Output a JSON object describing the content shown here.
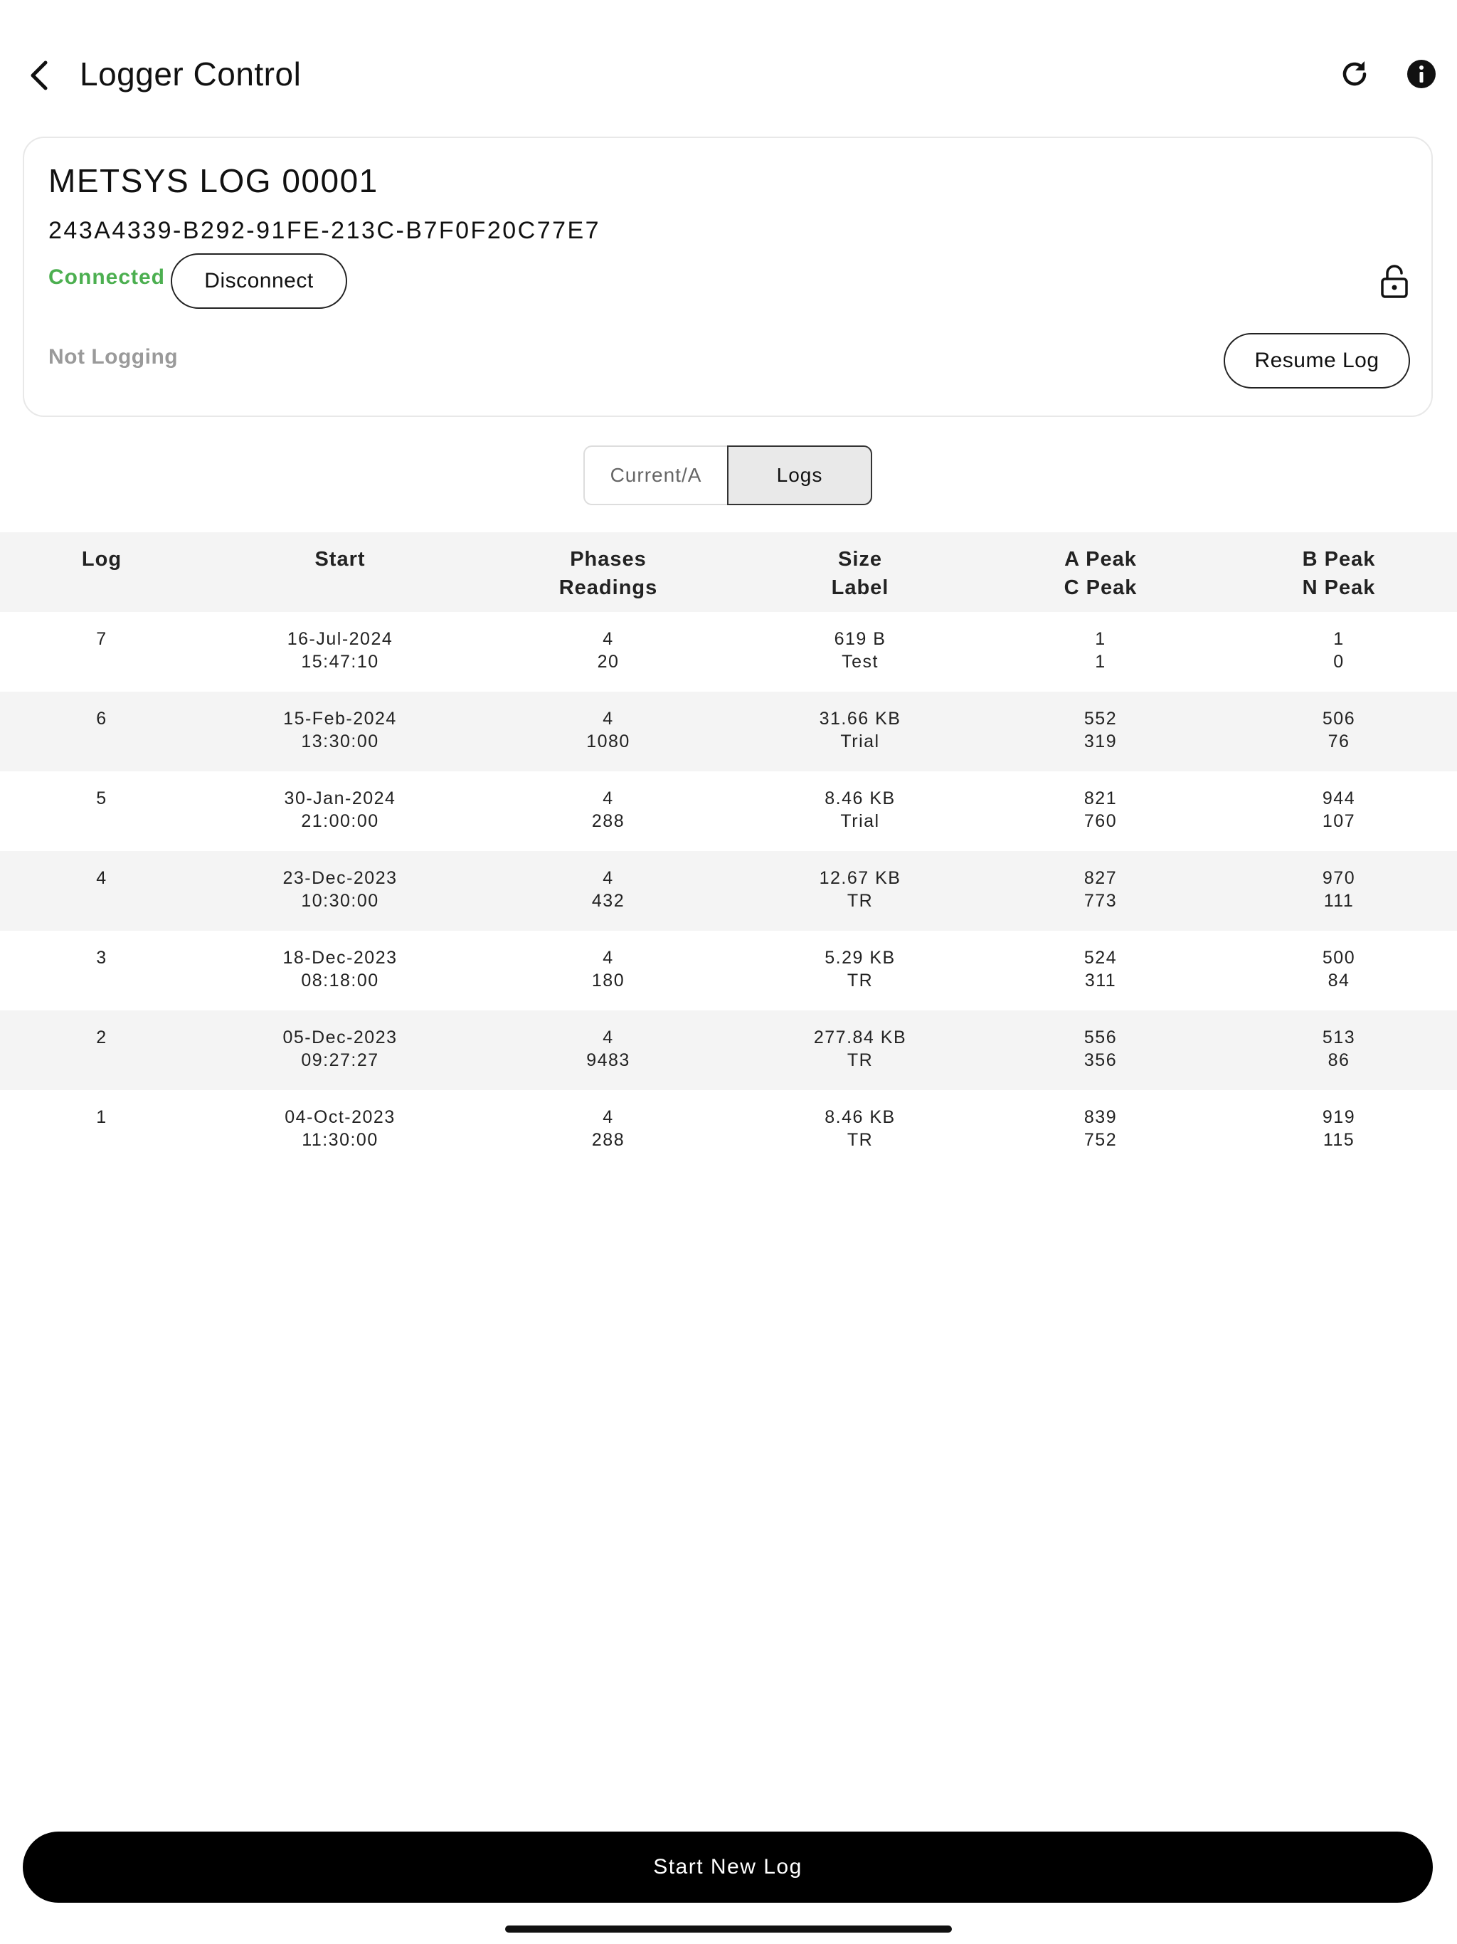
{
  "header": {
    "title": "Logger Control",
    "back_icon": "chevron-left-icon",
    "refresh_icon": "refresh-icon",
    "info_icon": "info-icon"
  },
  "device": {
    "name": "METSYS LOG 00001",
    "id": "243A4339-B292-91FE-213C-B7F0F20C77E7",
    "connection_status": "Connected",
    "disconnect_label": "Disconnect",
    "lock_icon": "unlock-icon",
    "logging_status": "Not Logging",
    "resume_label": "Resume Log"
  },
  "tabs": {
    "current": "Current/A",
    "logs": "Logs",
    "selected": "Logs"
  },
  "table": {
    "headers": [
      [
        "Log",
        ""
      ],
      [
        "Start",
        ""
      ],
      [
        "Phases",
        "Readings"
      ],
      [
        "Size",
        "Label"
      ],
      [
        "A Peak",
        "C Peak"
      ],
      [
        "B Peak",
        "N Peak"
      ]
    ],
    "rows": [
      [
        [
          "7",
          ""
        ],
        [
          "16-Jul-2024",
          "15:47:10"
        ],
        [
          "4",
          "20"
        ],
        [
          "619 B",
          "Test"
        ],
        [
          "1",
          "1"
        ],
        [
          "1",
          "0"
        ]
      ],
      [
        [
          "6",
          ""
        ],
        [
          "15-Feb-2024",
          "13:30:00"
        ],
        [
          "4",
          "1080"
        ],
        [
          "31.66 KB",
          "Trial"
        ],
        [
          "552",
          "319"
        ],
        [
          "506",
          "76"
        ]
      ],
      [
        [
          "5",
          ""
        ],
        [
          "30-Jan-2024",
          "21:00:00"
        ],
        [
          "4",
          "288"
        ],
        [
          "8.46 KB",
          "Trial"
        ],
        [
          "821",
          "760"
        ],
        [
          "944",
          "107"
        ]
      ],
      [
        [
          "4",
          ""
        ],
        [
          "23-Dec-2023",
          "10:30:00"
        ],
        [
          "4",
          "432"
        ],
        [
          "12.67 KB",
          "TR"
        ],
        [
          "827",
          "773"
        ],
        [
          "970",
          "111"
        ]
      ],
      [
        [
          "3",
          ""
        ],
        [
          "18-Dec-2023",
          "08:18:00"
        ],
        [
          "4",
          "180"
        ],
        [
          "5.29 KB",
          "TR"
        ],
        [
          "524",
          "311"
        ],
        [
          "500",
          "84"
        ]
      ],
      [
        [
          "2",
          ""
        ],
        [
          "05-Dec-2023",
          "09:27:27"
        ],
        [
          "4",
          "9483"
        ],
        [
          "277.84 KB",
          "TR"
        ],
        [
          "556",
          "356"
        ],
        [
          "513",
          "86"
        ]
      ],
      [
        [
          "1",
          ""
        ],
        [
          "04-Oct-2023",
          "11:30:00"
        ],
        [
          "4",
          "288"
        ],
        [
          "8.46 KB",
          "TR"
        ],
        [
          "839",
          "752"
        ],
        [
          "919",
          "115"
        ]
      ]
    ]
  },
  "footer": {
    "start_label": "Start New Log"
  },
  "colors": {
    "connected": "#4caf50",
    "not_logging": "#9a9a9a",
    "primary_button": "#000000",
    "row_alt": "#f4f4f4"
  }
}
